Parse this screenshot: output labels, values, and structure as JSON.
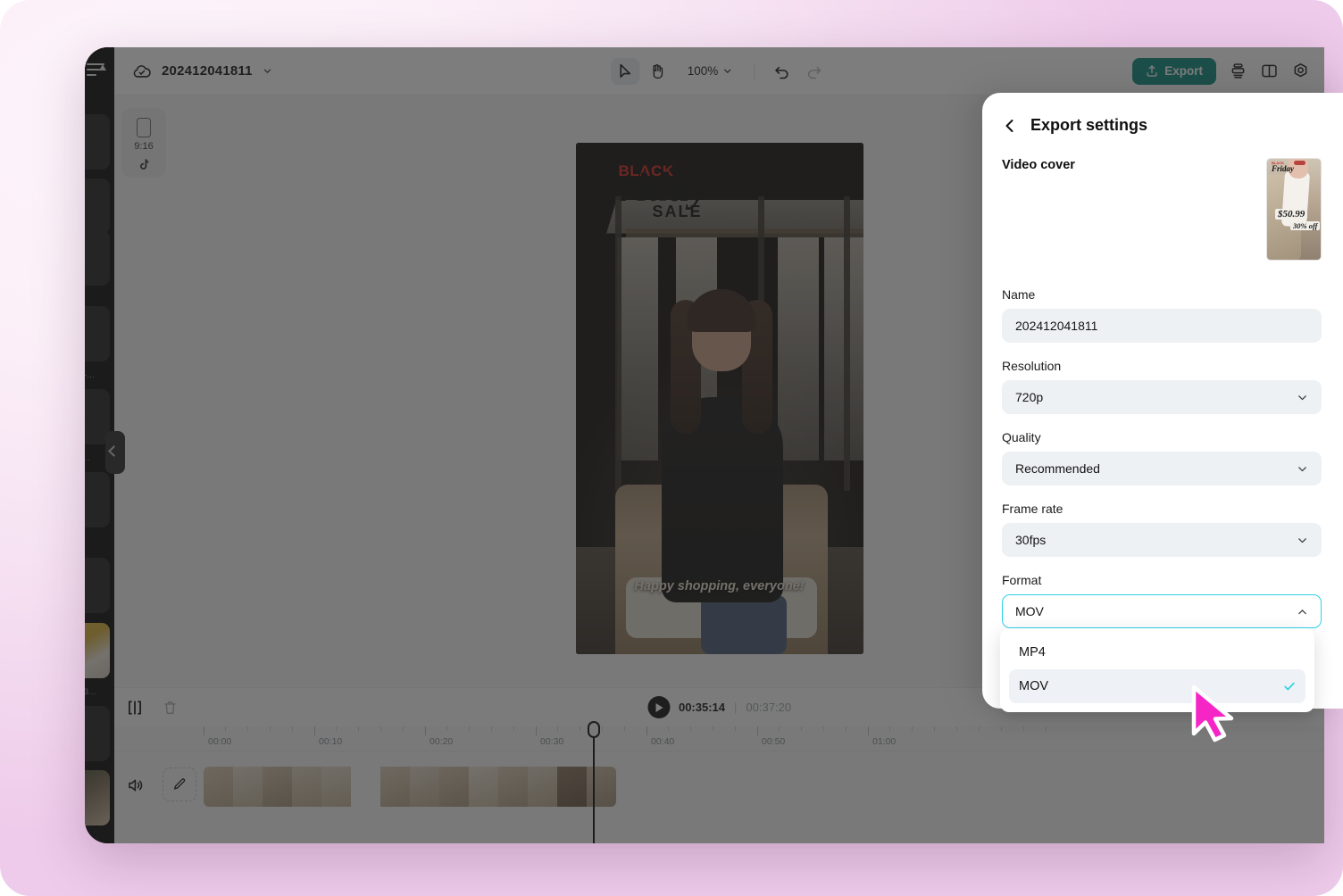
{
  "app": {
    "window_title": "202412041811"
  },
  "toolbar": {
    "cloud_icon": "cloud-check-icon",
    "project_title": "202412041811",
    "project_chevron": "chevron-down-icon",
    "select_tool": "cursor-arrow-icon",
    "hand_tool": "hand-icon",
    "zoom_level": "100%",
    "zoom_chevron": "chevron-down-icon",
    "undo_icon": "undo-icon",
    "redo_icon": "redo-icon",
    "export_label": "Export",
    "export_icon": "upload-icon",
    "export_color": "#0f8c80",
    "layers_icon": "layers-icon",
    "split-view_icon": "split-panel-icon",
    "settings_icon": "gear-icon"
  },
  "canvas": {
    "ratio_label": "9:16",
    "ratio_frame_icon": "phone-frame-icon",
    "platform_icon": "tiktok-icon",
    "overlay": {
      "black": "BLACK",
      "friday": "Friday",
      "sale": "SALE"
    },
    "caption": "Happy shopping, everyone!"
  },
  "transport": {
    "split_icon": "split-clip-icon",
    "delete_icon": "trash-icon",
    "play_icon": "play-icon",
    "current_time": "00:35:14",
    "divider": "|",
    "total_time": "00:37:20"
  },
  "timeline": {
    "ruler_labels": [
      "00:00",
      "00:10",
      "00:20",
      "00:30",
      "00:40",
      "00:50",
      "01:00"
    ],
    "mute_icon": "speaker-icon",
    "edit_icon": "pencil-icon",
    "playhead_position": "00:35:14"
  },
  "export_panel": {
    "back_icon": "chevron-left-icon",
    "title": "Export settings",
    "cover_label": "Video cover",
    "cover_thumb": {
      "price": "$50.99",
      "discount": "30% off",
      "badge_black": "BLACK",
      "badge_friday": "Friday"
    },
    "fields": [
      {
        "label": "Name",
        "value": "202412041811",
        "control": "text",
        "chevron": ""
      },
      {
        "label": "Resolution",
        "value": "720p",
        "control": "select",
        "chevron": "chevron-down-icon"
      },
      {
        "label": "Quality",
        "value": "Recommended",
        "control": "select",
        "chevron": "chevron-down-icon"
      },
      {
        "label": "Frame rate",
        "value": "30fps",
        "control": "select",
        "chevron": "chevron-down-icon"
      },
      {
        "label": "Format",
        "value": "MOV",
        "control": "select-open",
        "chevron": "chevron-up-icon"
      }
    ],
    "format_dropdown": {
      "options": [
        "MP4",
        "MOV"
      ],
      "selected": "MOV",
      "check_icon": "check-icon",
      "accent_color": "#2dd3e8"
    }
  },
  "cursor": {
    "icon": "pointer-cursor-icon",
    "color": "#f525c6"
  }
}
